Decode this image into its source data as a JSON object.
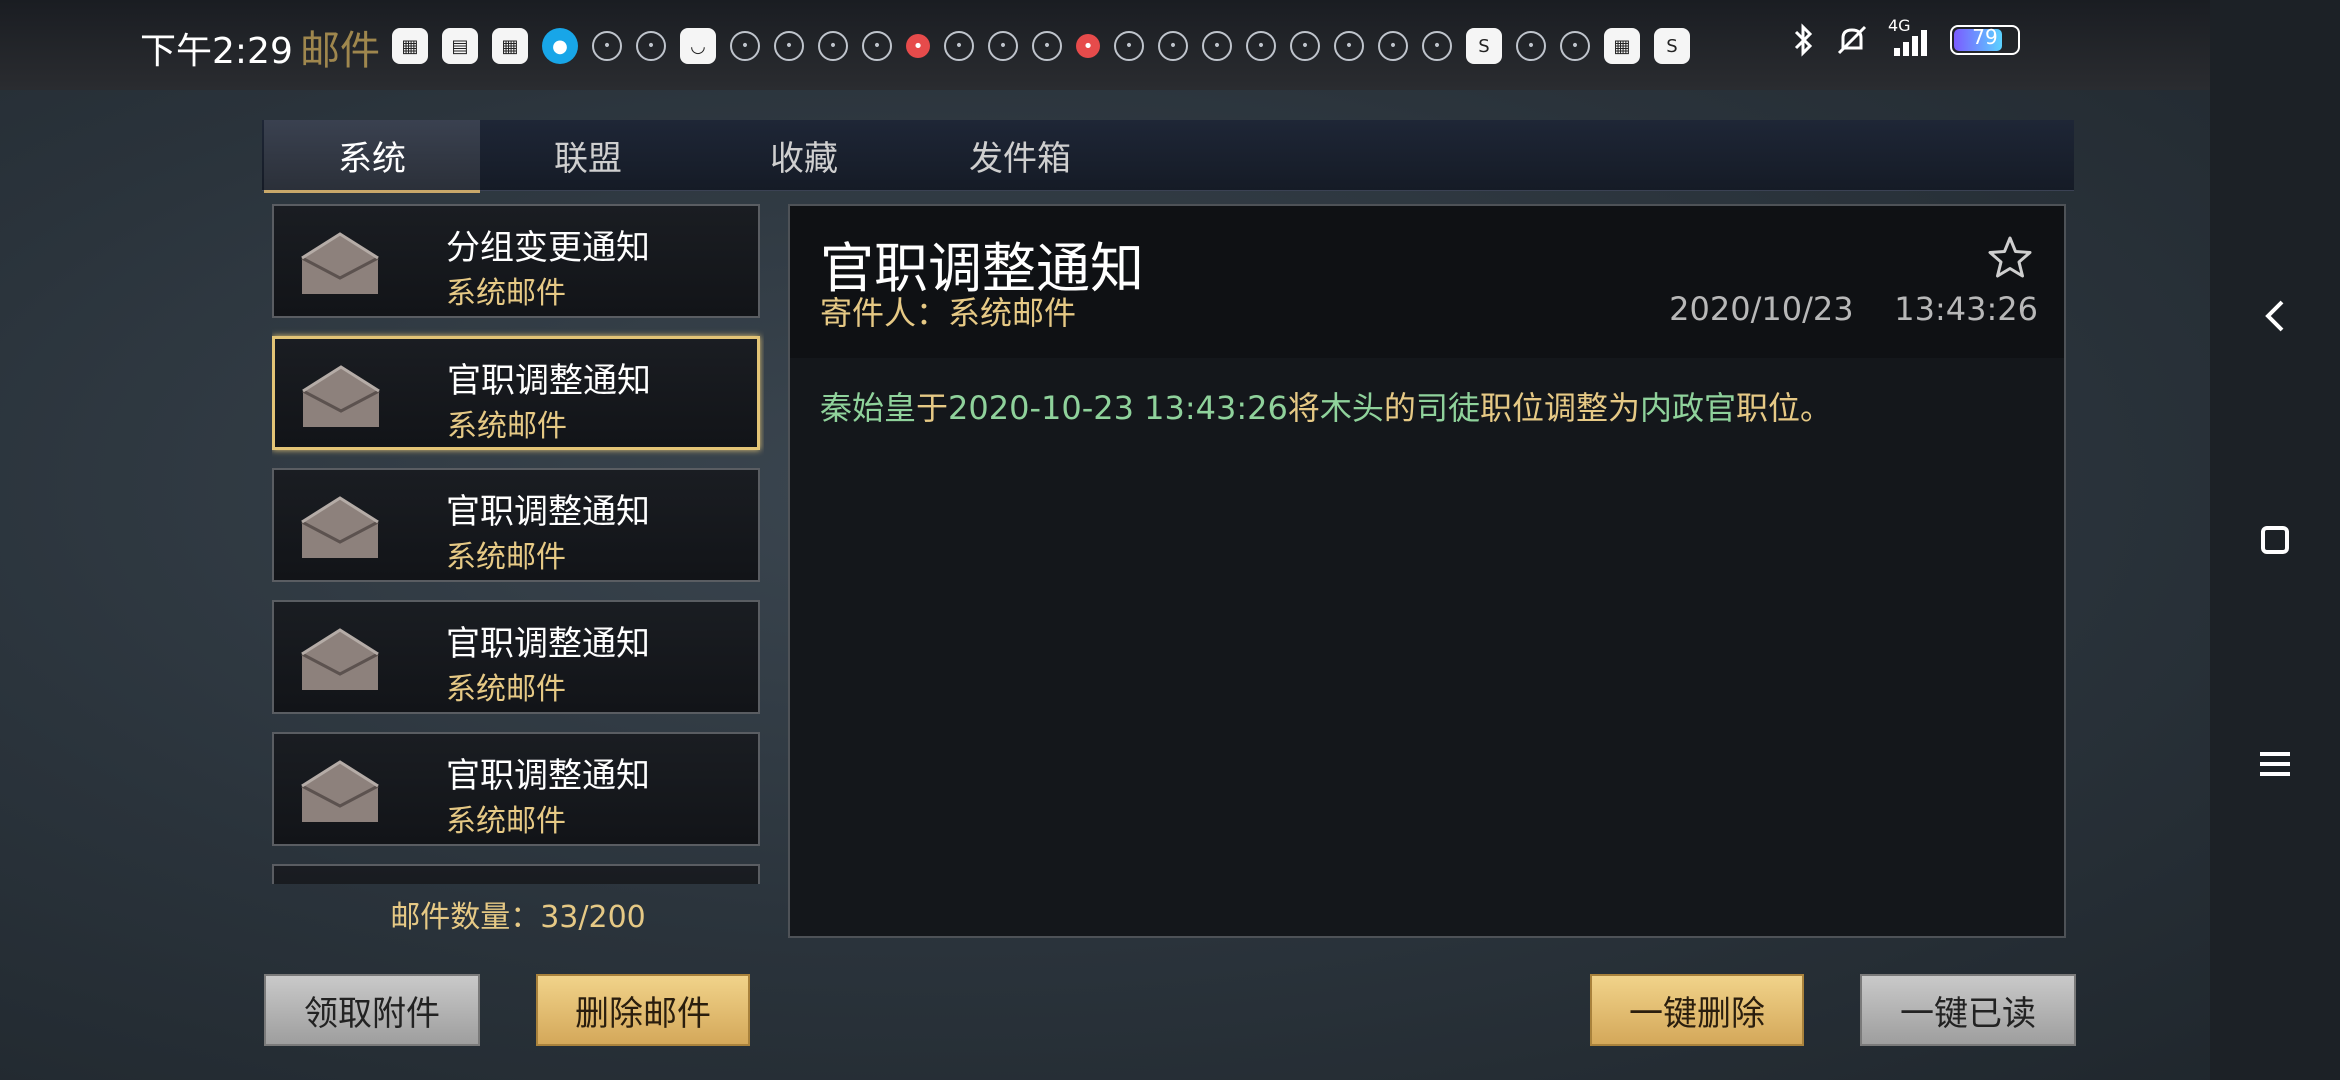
{
  "statusbar": {
    "time": "下午2:29",
    "app_title": "邮件",
    "network": "4G",
    "battery": "79",
    "battery_level": 0.79
  },
  "tabs": [
    {
      "label": "系统",
      "active": true
    },
    {
      "label": "联盟",
      "active": false
    },
    {
      "label": "收藏",
      "active": false
    },
    {
      "label": "发件箱",
      "active": false
    }
  ],
  "mails": [
    {
      "title": "分组变更通知",
      "sender": "系统邮件"
    },
    {
      "title": "官职调整通知",
      "sender": "系统邮件",
      "selected": true
    },
    {
      "title": "官职调整通知",
      "sender": "系统邮件"
    },
    {
      "title": "官职调整通知",
      "sender": "系统邮件"
    },
    {
      "title": "官职调整通知",
      "sender": "系统邮件"
    }
  ],
  "mail_count": "邮件数量：33/200",
  "detail": {
    "title": "官职调整通知",
    "sender": "寄件人：系统邮件",
    "date": "2020/10/23",
    "time": "13:43:26",
    "body": {
      "p1": "秦始皇",
      "p2": "于",
      "p3": "2020-10-23 13:43:26",
      "p4": "将",
      "p5": "木头",
      "p6": "的",
      "p7": "司徒",
      "p8": "职位调整为",
      "p9": "内政官",
      "p10": "职位。"
    }
  },
  "buttons": {
    "claim": "领取附件",
    "delete": "删除邮件",
    "delete_all": "一键删除",
    "read_all": "一键已读"
  },
  "colors": {
    "accent_gold": "#e6c985",
    "highlight_green": "#8fd29b"
  }
}
